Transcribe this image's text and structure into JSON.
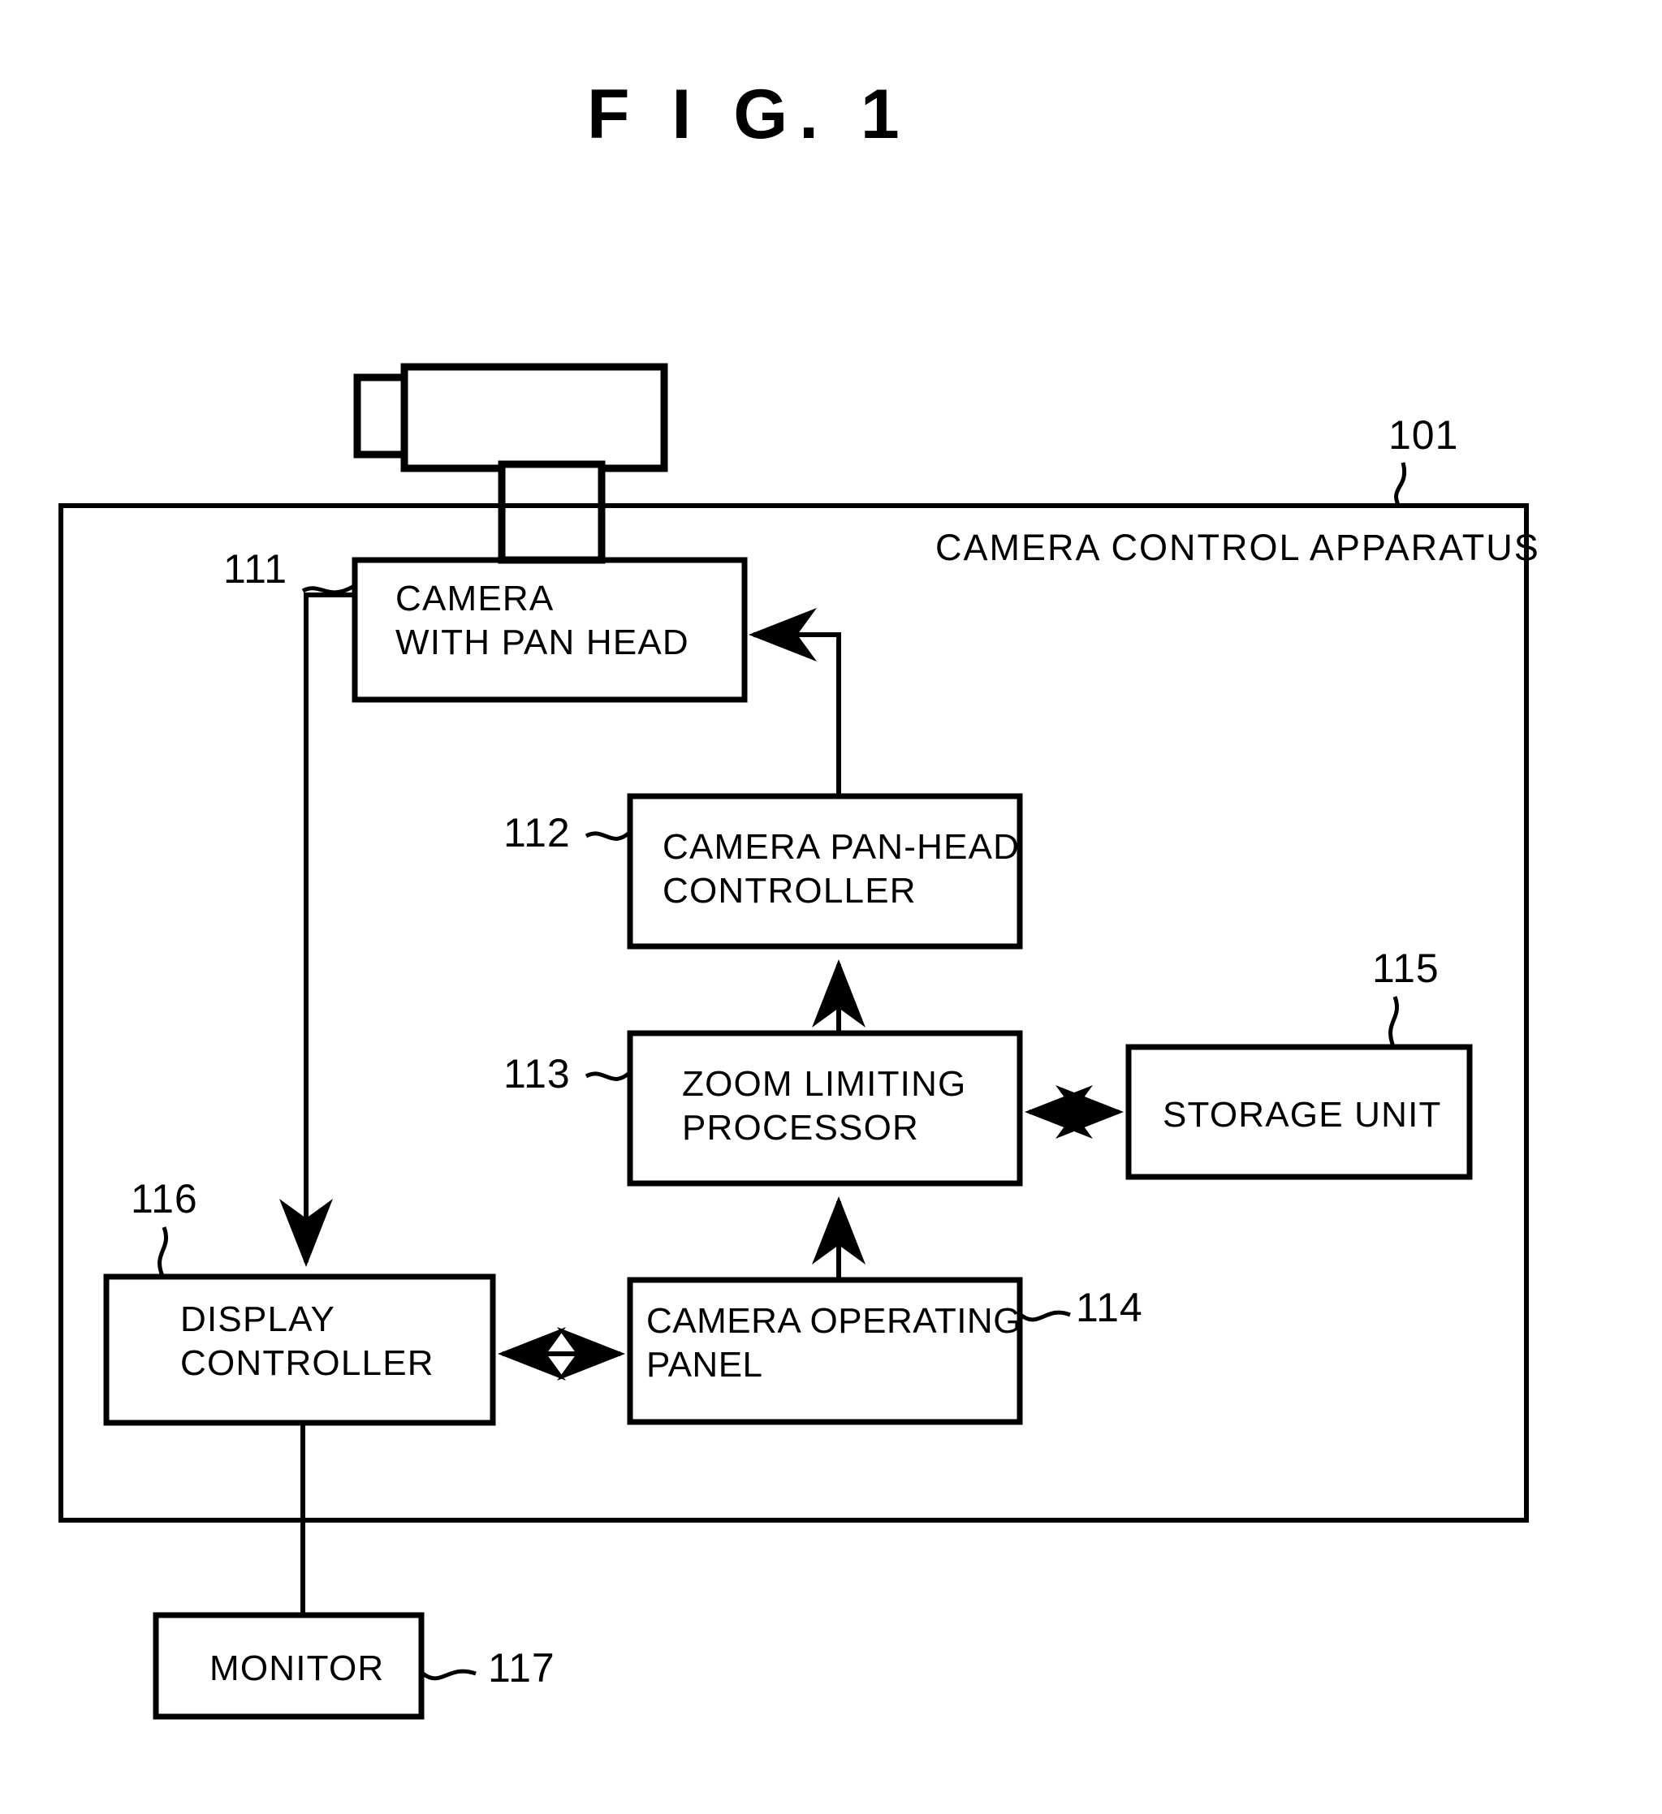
{
  "figure": {
    "title": "F I G.  1",
    "apparatus_label": "CAMERA CONTROL APPARATUS",
    "apparatus_ref": "101"
  },
  "blocks": [
    {
      "id": "camera-with-pan-head",
      "ref": "111",
      "line1": "CAMERA",
      "line2": "WITH PAN HEAD"
    },
    {
      "id": "camera-pan-head-controller",
      "ref": "112",
      "line1": "CAMERA PAN-HEAD",
      "line2": "CONTROLLER"
    },
    {
      "id": "zoom-limiting-processor",
      "ref": "113",
      "line1": "ZOOM LIMITING",
      "line2": "PROCESSOR"
    },
    {
      "id": "camera-operating-panel",
      "ref": "114",
      "line1": "CAMERA OPERATING",
      "line2": "PANEL"
    },
    {
      "id": "storage-unit",
      "ref": "115",
      "line1": "STORAGE UNIT",
      "line2": ""
    },
    {
      "id": "display-controller",
      "ref": "116",
      "line1": "DISPLAY",
      "line2": "CONTROLLER"
    },
    {
      "id": "monitor",
      "ref": "117",
      "line1": "MONITOR",
      "line2": ""
    }
  ],
  "icons": {
    "camera": "video-camera-icon"
  },
  "colors": {
    "ink": "#000000",
    "paper": "#ffffff"
  },
  "chart_data": {
    "type": "diagram",
    "title": "F I G.  1",
    "nodes": [
      {
        "ref": "101",
        "label": "CAMERA CONTROL APPARATUS",
        "shape": "enclosure"
      },
      {
        "ref": "111",
        "label": "CAMERA WITH PAN HEAD",
        "shape": "rect"
      },
      {
        "ref": "112",
        "label": "CAMERA PAN-HEAD CONTROLLER",
        "shape": "rect"
      },
      {
        "ref": "113",
        "label": "ZOOM LIMITING PROCESSOR",
        "shape": "rect"
      },
      {
        "ref": "114",
        "label": "CAMERA OPERATING PANEL",
        "shape": "rect"
      },
      {
        "ref": "115",
        "label": "STORAGE UNIT",
        "shape": "rect"
      },
      {
        "ref": "116",
        "label": "DISPLAY CONTROLLER",
        "shape": "rect"
      },
      {
        "ref": "117",
        "label": "MONITOR",
        "shape": "rect"
      }
    ],
    "edges": [
      {
        "from": "112",
        "to": "111",
        "arrow": "single"
      },
      {
        "from": "111",
        "to": "116",
        "arrow": "single"
      },
      {
        "from": "113",
        "to": "112",
        "arrow": "single"
      },
      {
        "from": "114",
        "to": "113",
        "arrow": "single"
      },
      {
        "from": "113",
        "to": "115",
        "arrow": "double"
      },
      {
        "from": "116",
        "to": "114",
        "arrow": "double"
      },
      {
        "from": "116",
        "to": "117",
        "arrow": "none"
      }
    ]
  }
}
